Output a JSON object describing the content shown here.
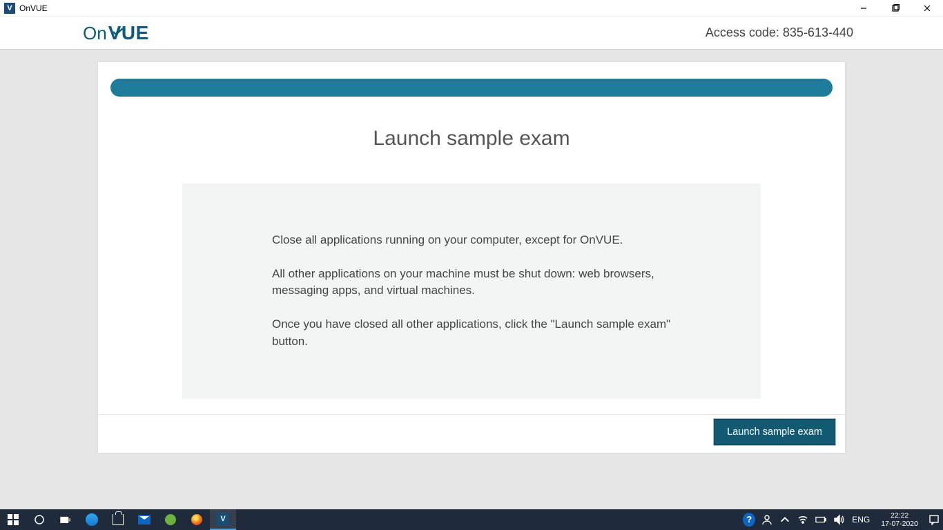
{
  "window": {
    "title": "OnVUE"
  },
  "header": {
    "logo_on": "On",
    "logo_vue": "VUE",
    "access_code_label": "Access code: ",
    "access_code": "835-613-440"
  },
  "main": {
    "title": "Launch sample exam",
    "paragraphs": [
      "Close all applications running on your computer, except for OnVUE.",
      "All other applications on your machine must be shut down: web browsers, messaging apps, and virtual machines.",
      "Once you have closed all other applications, click the \"Launch sample exam\" button."
    ],
    "button_label": "Launch sample exam"
  },
  "taskbar": {
    "lang": "ENG",
    "time": "22:22",
    "date": "17-07-2020"
  }
}
